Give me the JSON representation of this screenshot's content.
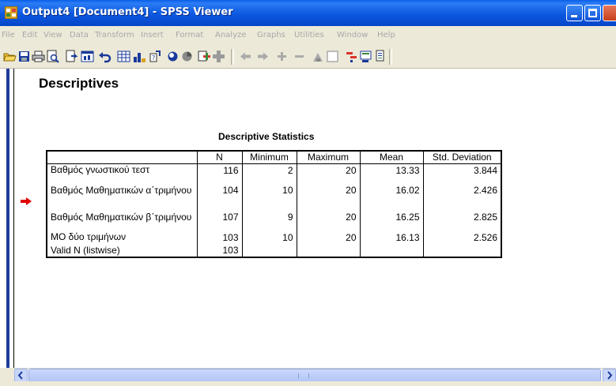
{
  "window": {
    "title": "Output4 [Document4] - SPSS Viewer",
    "title_color": "#0a5ee6"
  },
  "menu": {
    "items": [
      "File",
      "Edit",
      "View",
      "Data",
      "Transform",
      "Insert",
      "Format",
      "Analyze",
      "Graphs",
      "Utilities",
      "Window",
      "Help"
    ]
  },
  "toolbar": {
    "icons": [
      "open-icon",
      "save-icon",
      "print-icon",
      "print-preview-icon",
      "export-icon",
      "goto-data-icon",
      "undo-icon",
      "goto-case-icon",
      "variables-icon",
      "insert-variable-icon",
      "circle-icon",
      "pie-icon",
      "insert-cases-icon",
      "add-icon",
      "arrow-left-icon",
      "arrow-right-icon",
      "plus-icon",
      "minus-icon",
      "show-all-icon",
      "hide-icon",
      "insert-heading-icon",
      "insert-title-icon",
      "insert-text-icon"
    ]
  },
  "output": {
    "heading": "Descriptives",
    "table_title": "Descriptive Statistics",
    "columns": [
      "",
      "N",
      "Minimum",
      "Maximum",
      "Mean",
      "Std. Deviation"
    ],
    "rows": [
      {
        "label": "Βαθμός γνωστικού τεστ",
        "n": "116",
        "min": "2",
        "max": "20",
        "mean": "13.33",
        "sd": "3.844"
      },
      {
        "label": "Βαθμός Μαθηματικών α΄τριμήνου",
        "n": "104",
        "min": "10",
        "max": "20",
        "mean": "16.02",
        "sd": "2.426"
      },
      {
        "label": "Βαθμός Μαθηματικών β΄τριμήνου",
        "n": "107",
        "min": "9",
        "max": "20",
        "mean": "16.25",
        "sd": "2.825"
      },
      {
        "label": "ΜΟ δύο τριμήνων",
        "n": "103",
        "min": "10",
        "max": "20",
        "mean": "16.13",
        "sd": "2.526"
      },
      {
        "label": "Valid N (listwise)",
        "n": "103",
        "min": "",
        "max": "",
        "mean": "",
        "sd": ""
      }
    ],
    "arrow_color": "#e00000"
  }
}
